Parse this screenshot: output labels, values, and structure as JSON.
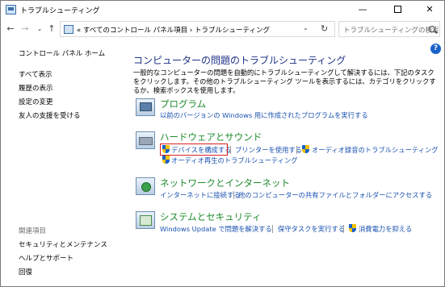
{
  "window": {
    "title": "トラブルシューティング",
    "min_glyph": "—",
    "close_glyph": "✕"
  },
  "nav": {
    "back_glyph": "←",
    "forward_glyph": "→",
    "recent_glyph": "⌄",
    "up_glyph": "↑",
    "address_text": "« すべてのコントロール パネル項目 › トラブルシューティング",
    "address_drop_glyph": "⌄",
    "refresh_glyph": "↻",
    "search_placeholder": "トラブルシューティングの検索"
  },
  "help": {
    "glyph": "?"
  },
  "sidebar": {
    "home": "コントロール パネル ホーム",
    "links": [
      "すべて表示",
      "履歴の表示",
      "設定の変更",
      "友人の支援を受ける"
    ],
    "related_heading": "関連項目",
    "related": [
      "セキュリティとメンテナンス",
      "ヘルプとサポート",
      "回復"
    ]
  },
  "main": {
    "title": "コンピューターの問題のトラブルシューティング",
    "description": "一般的なコンピューターの問題を自動的にトラブルシューティングして解決するには、下記のタスクをクリックします。その他のトラブルシューティング ツールを表示するには、カテゴリをクリックするか、検索ボックスを使用します。",
    "categories": [
      {
        "title": "プログラム",
        "tasks": [
          "以前のバージョンの Windows 用に作成されたプログラムを実行する"
        ]
      },
      {
        "title": "ハードウェアとサウンド",
        "tasks": [
          "デバイスを構成する",
          "プリンターを使用する",
          "オーディオ録音のトラブルシューティング",
          "オーディオ再生のトラブルシューティング"
        ]
      },
      {
        "title": "ネットワークとインターネット",
        "tasks": [
          "インターネットに接続する",
          "他のコンピューターの共有ファイルとフォルダーにアクセスする"
        ]
      },
      {
        "title": "システムとセキュリティ",
        "tasks": [
          "Windows Update で問題を解決する",
          "保守タスクを実行する",
          "消費電力を抑える"
        ]
      }
    ]
  },
  "colors": {
    "title_blue": "#1e3287",
    "category_green": "#1e8a2c",
    "link_blue": "#1a52b0",
    "highlight_red": "#d92020"
  }
}
